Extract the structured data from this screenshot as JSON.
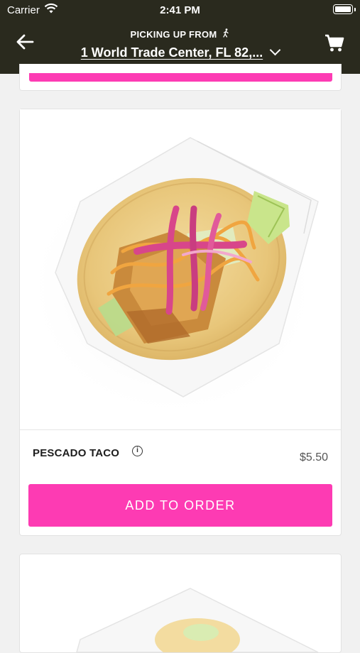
{
  "status_bar": {
    "carrier": "Carrier",
    "time": "2:41 PM"
  },
  "header": {
    "pickup_label": "PICKING UP FROM",
    "location": "1 World Trade Center, FL 82,...",
    "icons": [
      "back-arrow-icon",
      "walking-person-icon",
      "chevron-down-icon",
      "cart-icon"
    ]
  },
  "menu_item": {
    "name": "PESCADO TACO",
    "price": "$5.50",
    "add_button_label": "ADD TO ORDER"
  },
  "colors": {
    "header_bg": "#2a2a1e",
    "accent": "#fd3bb3",
    "page_bg": "#f1f1f1"
  }
}
